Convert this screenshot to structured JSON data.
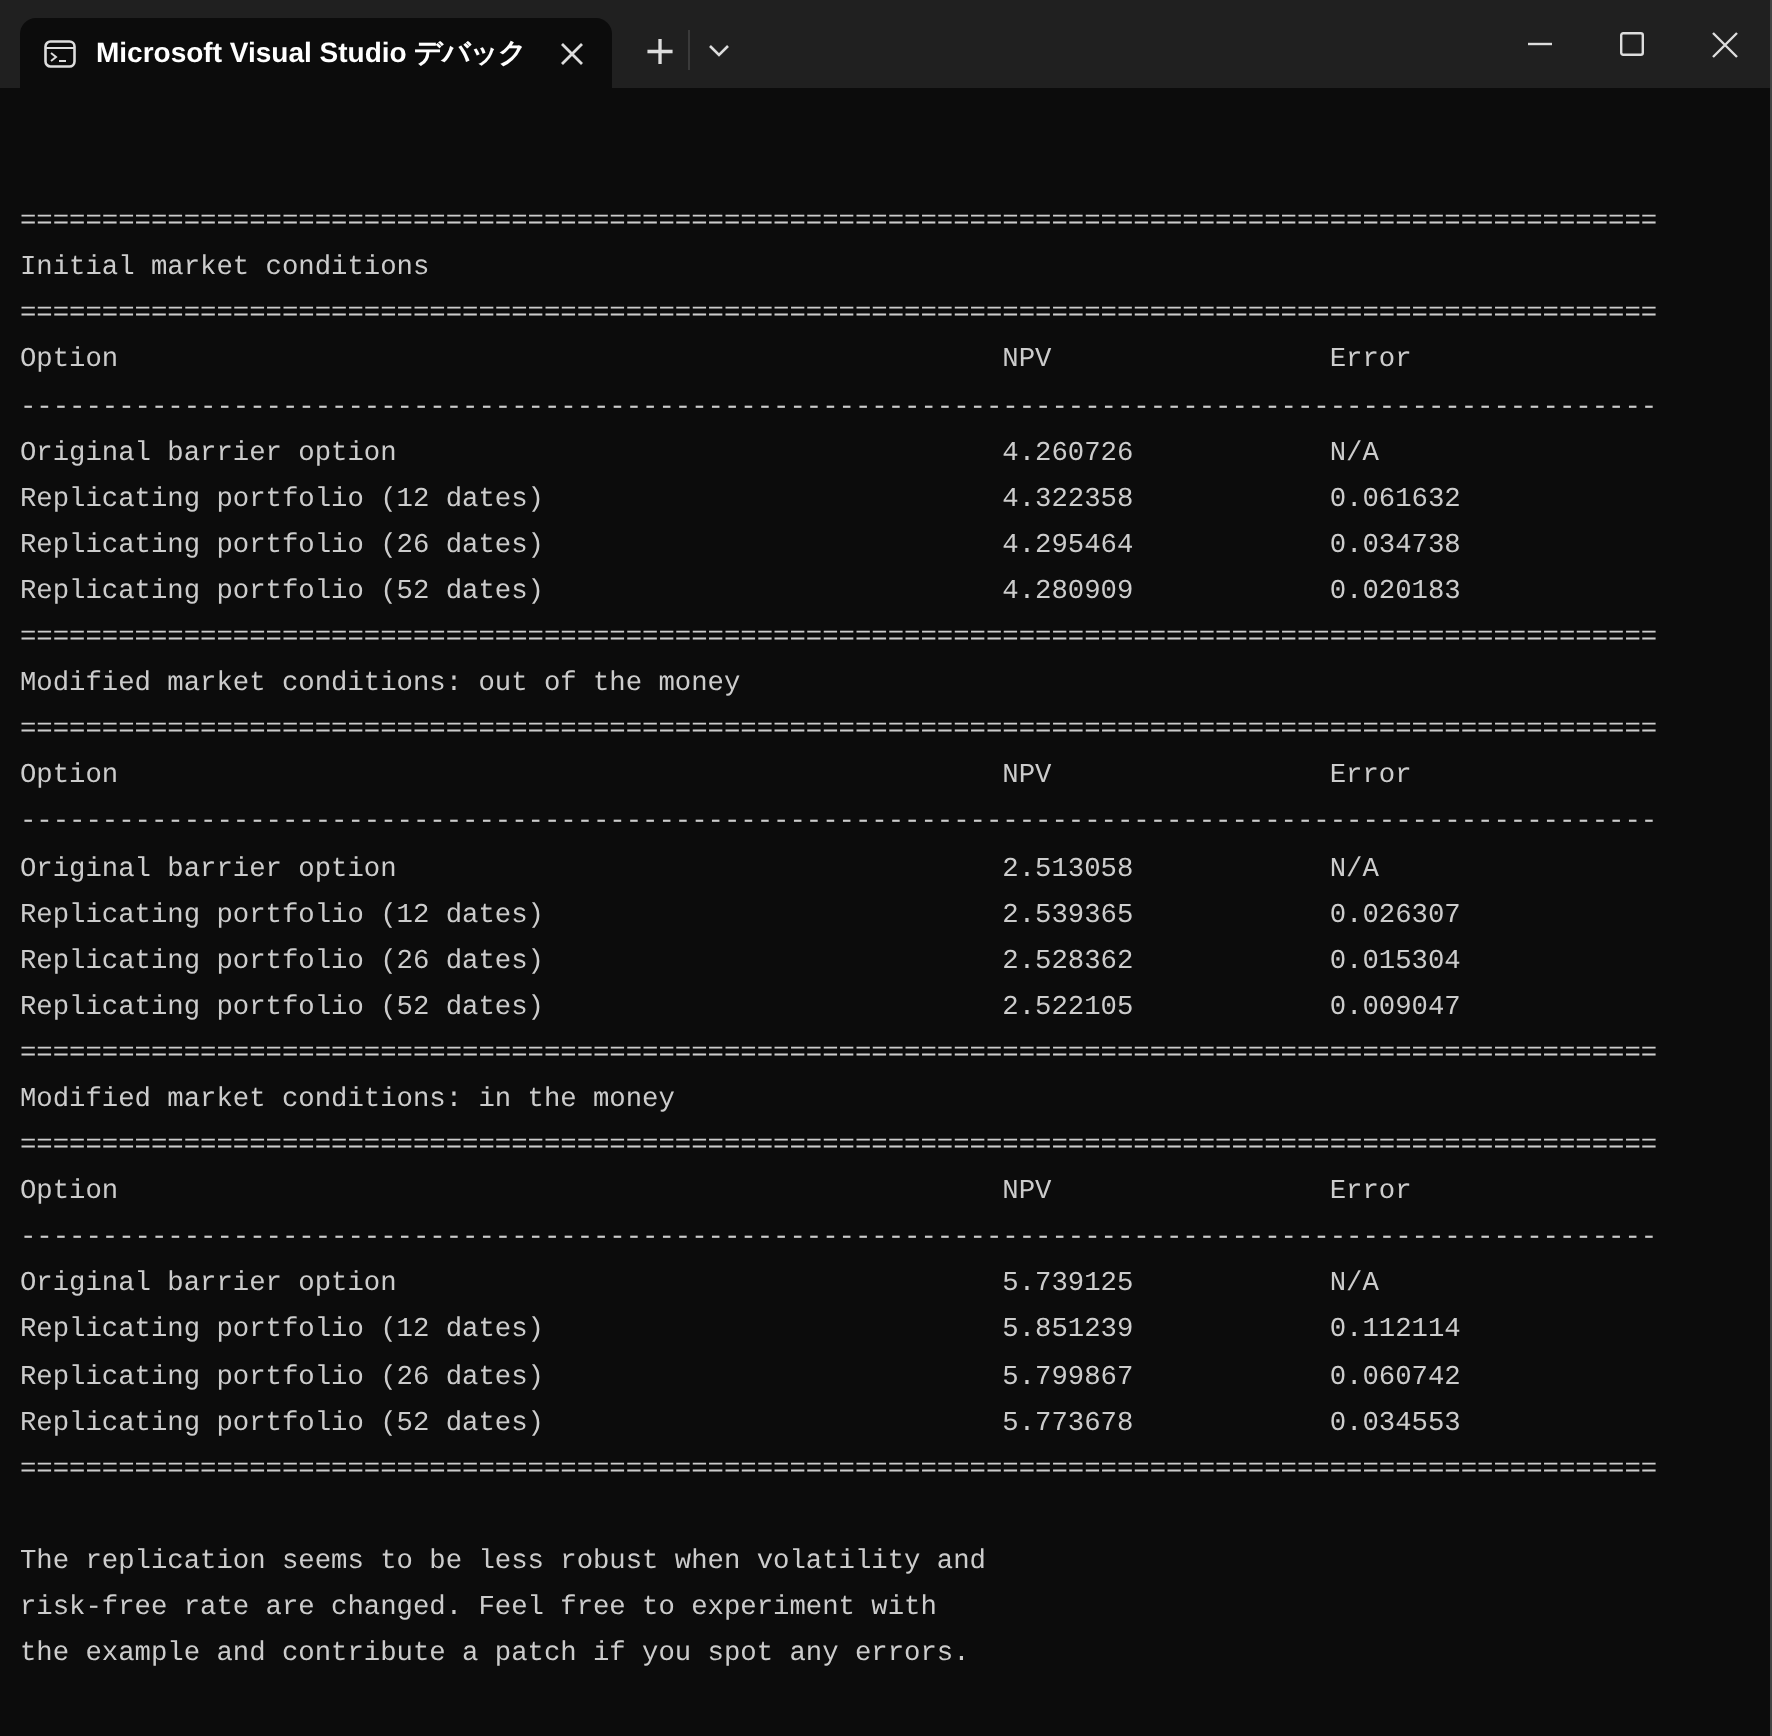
{
  "window": {
    "tab_title": "Microsoft Visual Studio デバック",
    "new_tab": "+"
  },
  "console": {
    "lines": [
      {
        "kind": "blank"
      },
      {
        "kind": "blank"
      },
      {
        "kind": "rule",
        "text": "===================================================================================================="
      },
      {
        "kind": "heading",
        "text": "Initial market conditions"
      },
      {
        "kind": "rule",
        "text": "===================================================================================================="
      },
      {
        "kind": "header",
        "cells": [
          "Option",
          "NPV",
          "Error"
        ]
      },
      {
        "kind": "rule",
        "text": "----------------------------------------------------------------------------------------------------"
      },
      {
        "kind": "row",
        "cells": [
          "Original barrier option",
          "4.260726",
          "N/A"
        ]
      },
      {
        "kind": "row",
        "cells": [
          "Replicating portfolio (12 dates)",
          "4.322358",
          "0.061632"
        ]
      },
      {
        "kind": "row",
        "cells": [
          "Replicating portfolio (26 dates)",
          "4.295464",
          "0.034738"
        ]
      },
      {
        "kind": "row",
        "cells": [
          "Replicating portfolio (52 dates)",
          "4.280909",
          "0.020183"
        ]
      },
      {
        "kind": "rule",
        "text": "===================================================================================================="
      },
      {
        "kind": "heading",
        "text": "Modified market conditions: out of the money"
      },
      {
        "kind": "rule",
        "text": "===================================================================================================="
      },
      {
        "kind": "header",
        "cells": [
          "Option",
          "NPV",
          "Error"
        ]
      },
      {
        "kind": "rule",
        "text": "----------------------------------------------------------------------------------------------------"
      },
      {
        "kind": "row",
        "cells": [
          "Original barrier option",
          "2.513058",
          "N/A"
        ]
      },
      {
        "kind": "row",
        "cells": [
          "Replicating portfolio (12 dates)",
          "2.539365",
          "0.026307"
        ]
      },
      {
        "kind": "row",
        "cells": [
          "Replicating portfolio (26 dates)",
          "2.528362",
          "0.015304"
        ]
      },
      {
        "kind": "row",
        "cells": [
          "Replicating portfolio (52 dates)",
          "2.522105",
          "0.009047"
        ]
      },
      {
        "kind": "rule",
        "text": "===================================================================================================="
      },
      {
        "kind": "heading",
        "text": "Modified market conditions: in the money"
      },
      {
        "kind": "rule",
        "text": "===================================================================================================="
      },
      {
        "kind": "header",
        "cells": [
          "Option",
          "NPV",
          "Error"
        ]
      },
      {
        "kind": "rule",
        "text": "----------------------------------------------------------------------------------------------------"
      },
      {
        "kind": "row",
        "cells": [
          "Original barrier option",
          "5.739125",
          "N/A"
        ]
      },
      {
        "kind": "row",
        "cells": [
          "Replicating portfolio (12 dates)",
          "5.851239",
          "0.112114"
        ]
      },
      {
        "kind": "row",
        "cells": [
          "Replicating portfolio (26 dates)",
          "5.799867",
          "0.060742"
        ]
      },
      {
        "kind": "row",
        "cells": [
          "Replicating portfolio (52 dates)",
          "5.773678",
          "0.034553"
        ]
      },
      {
        "kind": "rule",
        "text": "===================================================================================================="
      },
      {
        "kind": "blank"
      },
      {
        "kind": "text",
        "text": "The replication seems to be less robust when volatility and"
      },
      {
        "kind": "text",
        "text": "risk-free rate are changed. Feel free to experiment with"
      },
      {
        "kind": "text",
        "text": "the example and contribute a patch if you spot any errors."
      }
    ]
  }
}
